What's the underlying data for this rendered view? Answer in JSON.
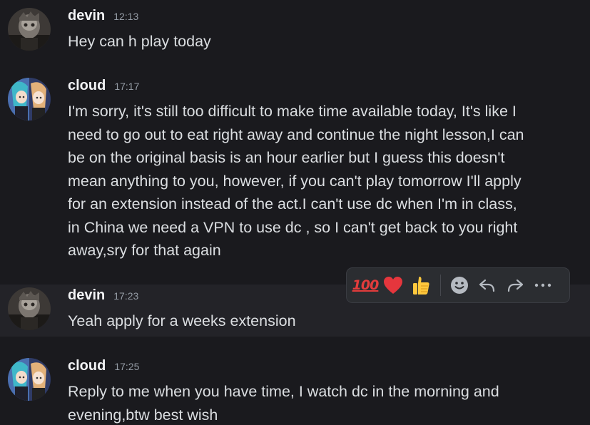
{
  "messages": [
    {
      "author": "devin",
      "time": "12:13",
      "lines": [
        "Hey can h play today"
      ]
    },
    {
      "author": "cloud",
      "time": "17:17",
      "lines": [
        "I'm sorry, it's still too difficult to make time available today, It's like I",
        "need to go out to eat right away and continue the night lesson,I can",
        "be on the original basis is an hour earlier but I guess this doesn't",
        "mean anything to you, however, if you can't play tomorrow I'll apply",
        "for an extension instead of the act.I can't use dc when I'm in class,",
        "in China we need a VPN to use dc , so I can't get back to you right",
        "away,sry for that again"
      ]
    },
    {
      "author": "devin",
      "time": "17:23",
      "lines": [
        "Yeah apply for a weeks extension"
      ]
    },
    {
      "author": "cloud",
      "time": "17:25",
      "lines": [
        "Reply to me when you have time, I watch dc in the morning and",
        "evening,btw best wish"
      ]
    }
  ],
  "toolbar": {
    "reactions": [
      {
        "name": "hundred-points-icon",
        "text": "100"
      },
      {
        "name": "red-heart-icon"
      },
      {
        "name": "thumbs-up-icon"
      }
    ],
    "actions": [
      "add-reaction-icon",
      "reply-icon",
      "forward-icon",
      "more-options-icon"
    ]
  },
  "colors": {
    "background": "#1a1a1e",
    "hover_background": "#232328",
    "username": "#f2f3f5",
    "timestamp": "#949ba4",
    "message_text": "#dbdee1",
    "toolbar_background": "#2b2d31",
    "heart": "#e5363d",
    "hundred": "#e33c3c",
    "thumbs_up": "#ffc83d"
  }
}
